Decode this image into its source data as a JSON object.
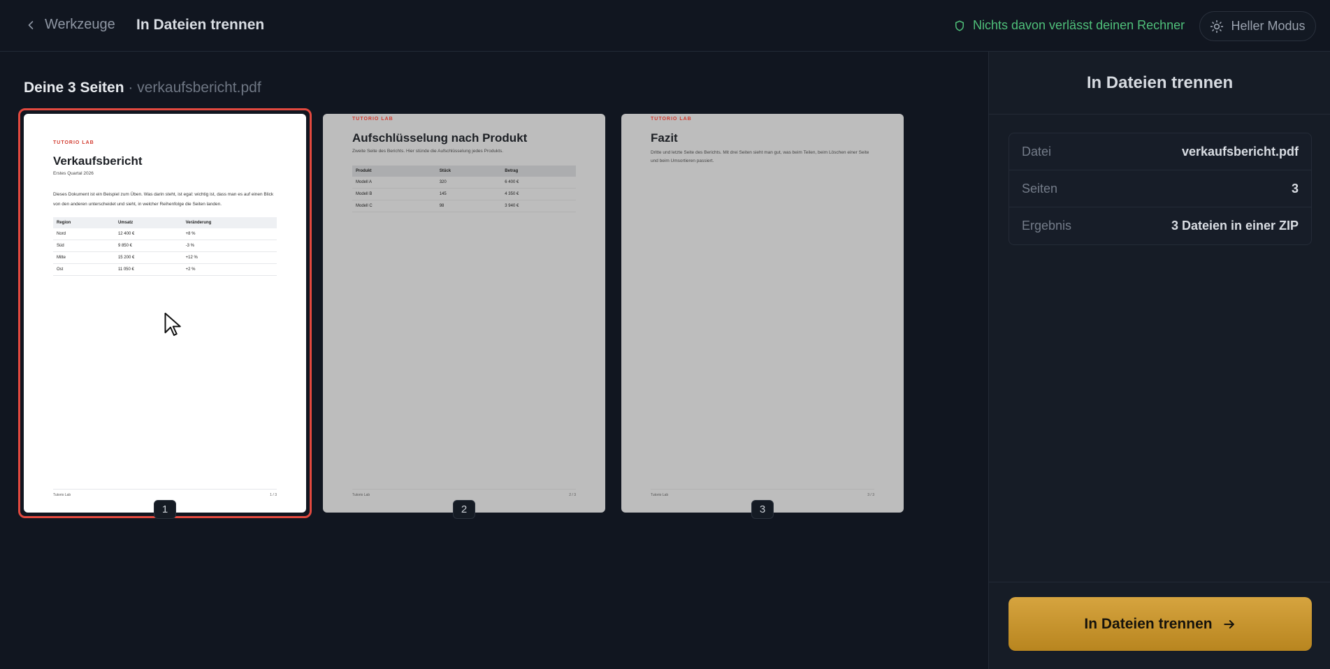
{
  "header": {
    "back_label": "Werkzeuge",
    "title": "In Dateien trennen",
    "privacy_note": "Nichts davon verlässt deinen Rechner",
    "theme_toggle": "Heller Modus"
  },
  "pages": {
    "heading": "Deine 3 Seiten",
    "separator": "·",
    "filename": "verkaufsbericht.pdf",
    "selected_page": 1,
    "items": [
      {
        "number": "1",
        "brand": "TUTORIO LAB",
        "title": "Verkaufsbericht",
        "subtitle": "Erstes Quartal 2026",
        "body": "Dieses Dokument ist ein Beispiel zum Üben. Was darin steht, ist egal: wichtig ist, dass man es auf einen Blick von den anderen unterscheidet und sieht, in welcher Reihenfolge die Seiten landen.",
        "table": {
          "headers": [
            "Region",
            "Umsatz",
            "Veränderung"
          ],
          "rows": [
            [
              "Nord",
              "12 400 €",
              "+8 %"
            ],
            [
              "Süd",
              "9 850 €",
              "-3 %"
            ],
            [
              "Mitte",
              "15 200 €",
              "+12 %"
            ],
            [
              "Ost",
              "11 050 €",
              "+2 %"
            ]
          ]
        },
        "footer_left": "Tutorio Lab",
        "footer_right": "1 / 3"
      },
      {
        "number": "2",
        "brand": "TUTORIO LAB",
        "title": "Aufschlüsselung nach Produkt",
        "subtitle": "Zweite Seite des Berichts. Hier stünde die Aufschlüsselung jedes Produkts.",
        "table": {
          "headers": [
            "Produkt",
            "Stück",
            "Betrag"
          ],
          "rows": [
            [
              "Modell A",
              "320",
              "6 400 €"
            ],
            [
              "Modell B",
              "145",
              "4 350 €"
            ],
            [
              "Modell C",
              "98",
              "3 940 €"
            ]
          ]
        },
        "footer_left": "Tutorio Lab",
        "footer_right": "2 / 3"
      },
      {
        "number": "3",
        "brand": "TUTORIO LAB",
        "title": "Fazit",
        "subtitle": "Dritte und letzte Seite des Berichts. Mit drei Seiten sieht man gut, was beim Teilen, beim Löschen einer Seite und beim Umsortieren passiert.",
        "footer_left": "Tutorio Lab",
        "footer_right": "3 / 3"
      }
    ]
  },
  "panel": {
    "title": "In Dateien trennen",
    "rows": [
      {
        "key": "Datei",
        "value": "verkaufsbericht.pdf"
      },
      {
        "key": "Seiten",
        "value": "3"
      },
      {
        "key": "Ergebnis",
        "value": "3 Dateien in einer ZIP"
      }
    ],
    "action_label": "In Dateien trennen"
  },
  "colors": {
    "accent_gold": "#d6a43f",
    "selection_red": "#e2493f",
    "privacy_green": "#4fc07a",
    "background": "#111620"
  },
  "icons": {
    "back": "chevron-left-icon",
    "privacy": "shield-icon",
    "theme": "sun-icon",
    "action": "arrow-right-icon",
    "cursor": "mouse-pointer-icon"
  }
}
